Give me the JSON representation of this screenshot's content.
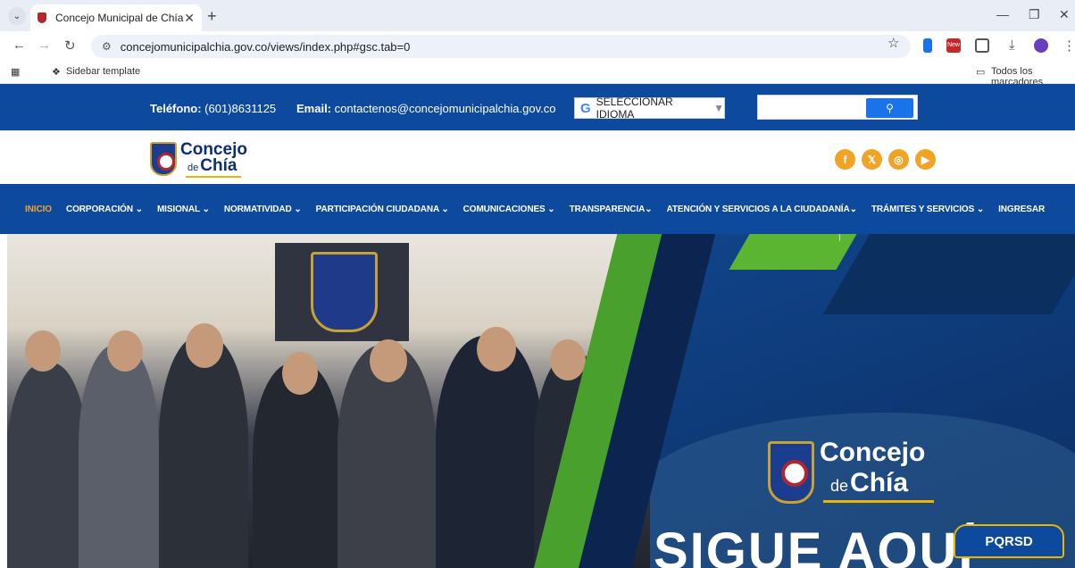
{
  "browser": {
    "tab_title": "Concejo Municipal de Chía",
    "url": "concejomunicipalchia.gov.co/views/index.php#gsc.tab=0",
    "bookmarks": [
      "Sidebar template"
    ],
    "all_bookmarks_label": "Todos los marcadores",
    "new_badge": "New"
  },
  "topbar": {
    "phone_label": "Teléfono:",
    "phone_value": "(601)8631125",
    "email_label": "Email:",
    "email_value": "contactenos@concejomunicipalchia.gov.co",
    "language_label": "SELECCIONAR IDIOMA",
    "language_arrow": "▼",
    "search_icon": "search-icon"
  },
  "logo": {
    "line1": "Concejo",
    "de": "de",
    "line2": "Chía"
  },
  "social": [
    "facebook-icon",
    "x-icon",
    "instagram-icon",
    "youtube-icon"
  ],
  "nav": {
    "items": [
      "INICIO",
      "CORPORACIÓN ⌄",
      "MISIONAL ⌄",
      "NORMATIVIDAD ⌄",
      "PARTICIPACIÓN CIUDADANA ⌄",
      "COMUNICACIONES ⌄",
      "TRANSPARENCIA⌄",
      "ATENCIÓN Y SERVICIOS A LA CIUDADANÍA⌄",
      "TRÁMITES Y SERVICIOS ⌄",
      "INGRESAR"
    ],
    "active_index": 0
  },
  "hero": {
    "logo_line1": "Concejo",
    "logo_de": "de",
    "logo_line2": "Chía",
    "headline": "SIGUE AQUÍ"
  },
  "pqrsd_label": "PQRSD",
  "colors": {
    "brand_blue": "#0d4a9e",
    "accent_orange": "#f0a324",
    "accent_green": "#4aa02c",
    "gold": "#e8b800"
  }
}
